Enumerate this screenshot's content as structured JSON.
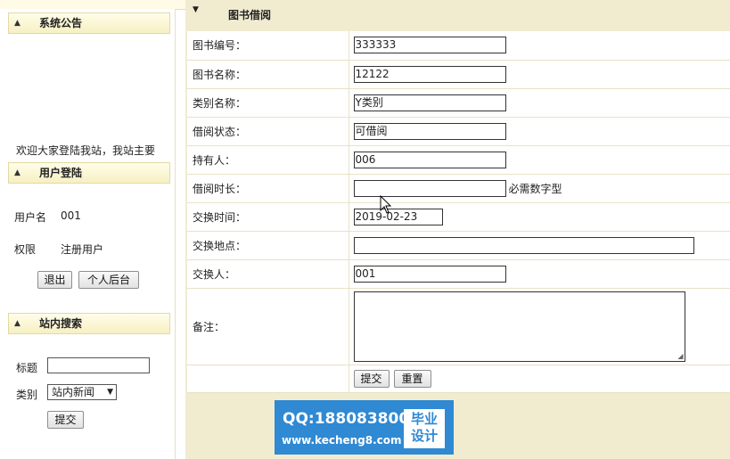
{
  "topbar": {
    "title_fragment": "..."
  },
  "sidebar": {
    "notice": {
      "header": "系统公告",
      "body": "欢迎大家登陆我站，我站主要"
    },
    "login": {
      "header": "用户登陆",
      "username_label": "用户名",
      "username_value": "001",
      "role_label": "权限",
      "role_value": "注册用户",
      "logout_button": "退出",
      "personal_button": "个人后台"
    },
    "search": {
      "header": "站内搜索",
      "title_label": "标题",
      "title_value": "",
      "category_label": "类别",
      "category_selected": "站内新闻",
      "submit_button": "提交"
    }
  },
  "form": {
    "title": "图书借阅",
    "fields": [
      {
        "label": "图书编号：",
        "value": "333333"
      },
      {
        "label": "图书名称：",
        "value": "12122"
      },
      {
        "label": "类别名称：",
        "value": "Y类别"
      },
      {
        "label": "借阅状态：",
        "value": "可借阅"
      },
      {
        "label": "持有人：",
        "value": "006"
      },
      {
        "label": "借阅时长：",
        "value": "",
        "hint": "必需数字型"
      },
      {
        "label": "交换时间：",
        "value": "2019-02-23"
      },
      {
        "label": "交换地点：",
        "value": ""
      },
      {
        "label": "交换人：",
        "value": "001"
      },
      {
        "label": "备注：",
        "value": ""
      }
    ],
    "submit_button": "提交",
    "reset_button": "重置"
  },
  "watermark": {
    "qq": "QQ:188083800",
    "url": "www.kecheng8.com",
    "badge_line1": "毕业",
    "badge_line2": "设计"
  },
  "colors": {
    "main_bg": "#f1ecd0",
    "panel_header": "#f7f0c3",
    "watermark_bg": "#2f89d3"
  }
}
